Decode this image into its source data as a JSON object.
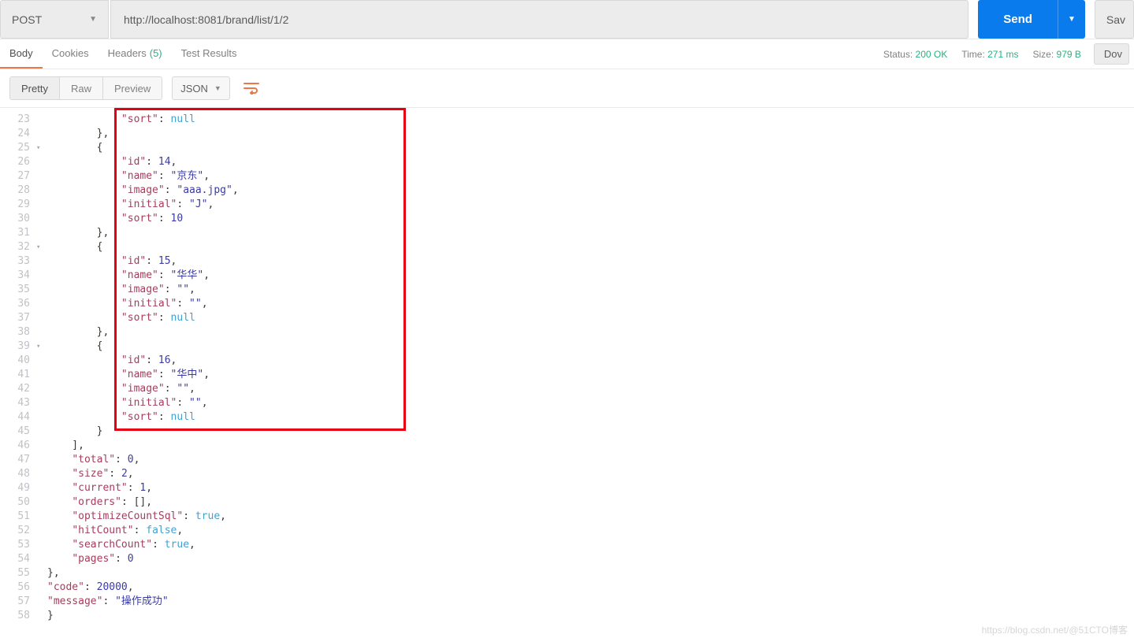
{
  "request": {
    "method": "POST",
    "url": "http://localhost:8081/brand/list/1/2",
    "send_label": "Send",
    "save_label": "Sav"
  },
  "response_tabs": {
    "body": "Body",
    "cookies": "Cookies",
    "headers": "Headers",
    "headers_count": "(5)",
    "tests": "Test Results"
  },
  "meta": {
    "status_label": "Status:",
    "status_value": "200 OK",
    "time_label": "Time:",
    "time_value": "271 ms",
    "size_label": "Size:",
    "size_value": "979 B",
    "download_label": "Dov"
  },
  "viewer": {
    "pretty": "Pretty",
    "raw": "Raw",
    "preview": "Preview",
    "format": "JSON"
  },
  "code": [
    {
      "n": 23,
      "f": "",
      "t": "            \"sort\": null"
    },
    {
      "n": 24,
      "f": "",
      "t": "        },"
    },
    {
      "n": 25,
      "f": "▾",
      "t": "        {"
    },
    {
      "n": 26,
      "f": "",
      "t": "            \"id\": 14,"
    },
    {
      "n": 27,
      "f": "",
      "t": "            \"name\": \"京东\","
    },
    {
      "n": 28,
      "f": "",
      "t": "            \"image\": \"aaa.jpg\","
    },
    {
      "n": 29,
      "f": "",
      "t": "            \"initial\": \"J\","
    },
    {
      "n": 30,
      "f": "",
      "t": "            \"sort\": 10"
    },
    {
      "n": 31,
      "f": "",
      "t": "        },"
    },
    {
      "n": 32,
      "f": "▾",
      "t": "        {"
    },
    {
      "n": 33,
      "f": "",
      "t": "            \"id\": 15,"
    },
    {
      "n": 34,
      "f": "",
      "t": "            \"name\": \"华华\","
    },
    {
      "n": 35,
      "f": "",
      "t": "            \"image\": \"\","
    },
    {
      "n": 36,
      "f": "",
      "t": "            \"initial\": \"\","
    },
    {
      "n": 37,
      "f": "",
      "t": "            \"sort\": null"
    },
    {
      "n": 38,
      "f": "",
      "t": "        },"
    },
    {
      "n": 39,
      "f": "▾",
      "t": "        {"
    },
    {
      "n": 40,
      "f": "",
      "t": "            \"id\": 16,"
    },
    {
      "n": 41,
      "f": "",
      "t": "            \"name\": \"华中\","
    },
    {
      "n": 42,
      "f": "",
      "t": "            \"image\": \"\","
    },
    {
      "n": 43,
      "f": "",
      "t": "            \"initial\": \"\","
    },
    {
      "n": 44,
      "f": "",
      "t": "            \"sort\": null"
    },
    {
      "n": 45,
      "f": "",
      "t": "        }"
    },
    {
      "n": 46,
      "f": "",
      "t": "    ],"
    },
    {
      "n": 47,
      "f": "",
      "t": "    \"total\": 0,"
    },
    {
      "n": 48,
      "f": "",
      "t": "    \"size\": 2,"
    },
    {
      "n": 49,
      "f": "",
      "t": "    \"current\": 1,"
    },
    {
      "n": 50,
      "f": "",
      "t": "    \"orders\": [],"
    },
    {
      "n": 51,
      "f": "",
      "t": "    \"optimizeCountSql\": true,"
    },
    {
      "n": 52,
      "f": "",
      "t": "    \"hitCount\": false,"
    },
    {
      "n": 53,
      "f": "",
      "t": "    \"searchCount\": true,"
    },
    {
      "n": 54,
      "f": "",
      "t": "    \"pages\": 0"
    },
    {
      "n": 55,
      "f": "",
      "t": "},"
    },
    {
      "n": 56,
      "f": "",
      "t": "\"code\": 20000,"
    },
    {
      "n": 57,
      "f": "",
      "t": "\"message\": \"操作成功\""
    },
    {
      "n": 58,
      "f": "",
      "t": "}"
    }
  ],
  "watermark": "https://blog.csdn.net/@51CTO博客"
}
